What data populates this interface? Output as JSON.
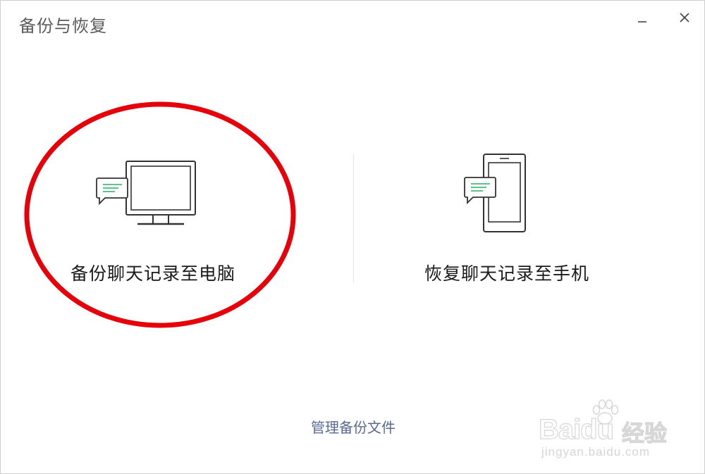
{
  "window": {
    "title": "备份与恢复"
  },
  "options": {
    "backup": {
      "label": "备份聊天记录至电脑",
      "icon": "monitor-chat-icon"
    },
    "restore": {
      "label": "恢复聊天记录至手机",
      "icon": "phone-chat-icon"
    }
  },
  "footer": {
    "manage_link": "管理备份文件"
  },
  "watermark": {
    "brand_text": "Baidu",
    "brand_cn": "经验",
    "url": "jingyan.baidu.com"
  },
  "colors": {
    "accent_green": "#2aae67",
    "link_blue": "#576b95",
    "highlight_red": "#e5000a"
  }
}
